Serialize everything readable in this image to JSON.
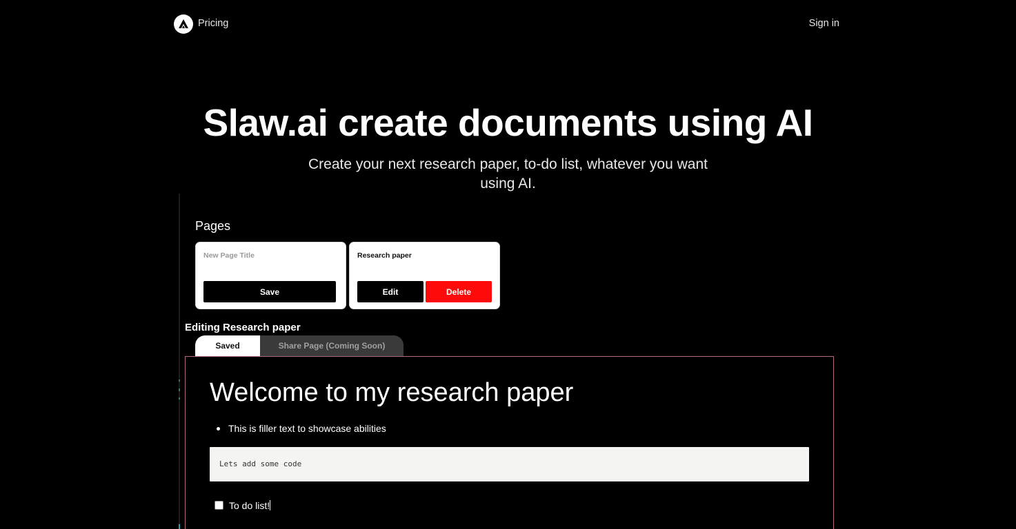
{
  "nav": {
    "logo_icon": "triangle-logo-icon",
    "pricing_label": "Pricing",
    "signin_label": "Sign in"
  },
  "hero": {
    "title": "Slaw.ai create documents using AI",
    "subtitle": "Create your next research paper, to-do list, whatever you want using AI."
  },
  "demo": {
    "pages_heading": "Pages",
    "new_page": {
      "placeholder": "New Page Title",
      "save_label": "Save"
    },
    "existing_page": {
      "title": "Research paper",
      "edit_label": "Edit",
      "delete_label": "Delete"
    },
    "editing_heading": "Editing Research paper",
    "tabs": [
      {
        "label": "Saved"
      },
      {
        "label": "Share Page (Coming Soon)"
      }
    ],
    "editor": {
      "heading": "Welcome to my research paper",
      "bullet": "This is filler text to showcase abilities",
      "code": "Lets add some code",
      "todo": "To do list!"
    }
  },
  "colors": {
    "background": "#000000",
    "delete": "#ff0a0a",
    "editor_border": "#b06a82",
    "tab_inactive": "#3a3a3a"
  }
}
